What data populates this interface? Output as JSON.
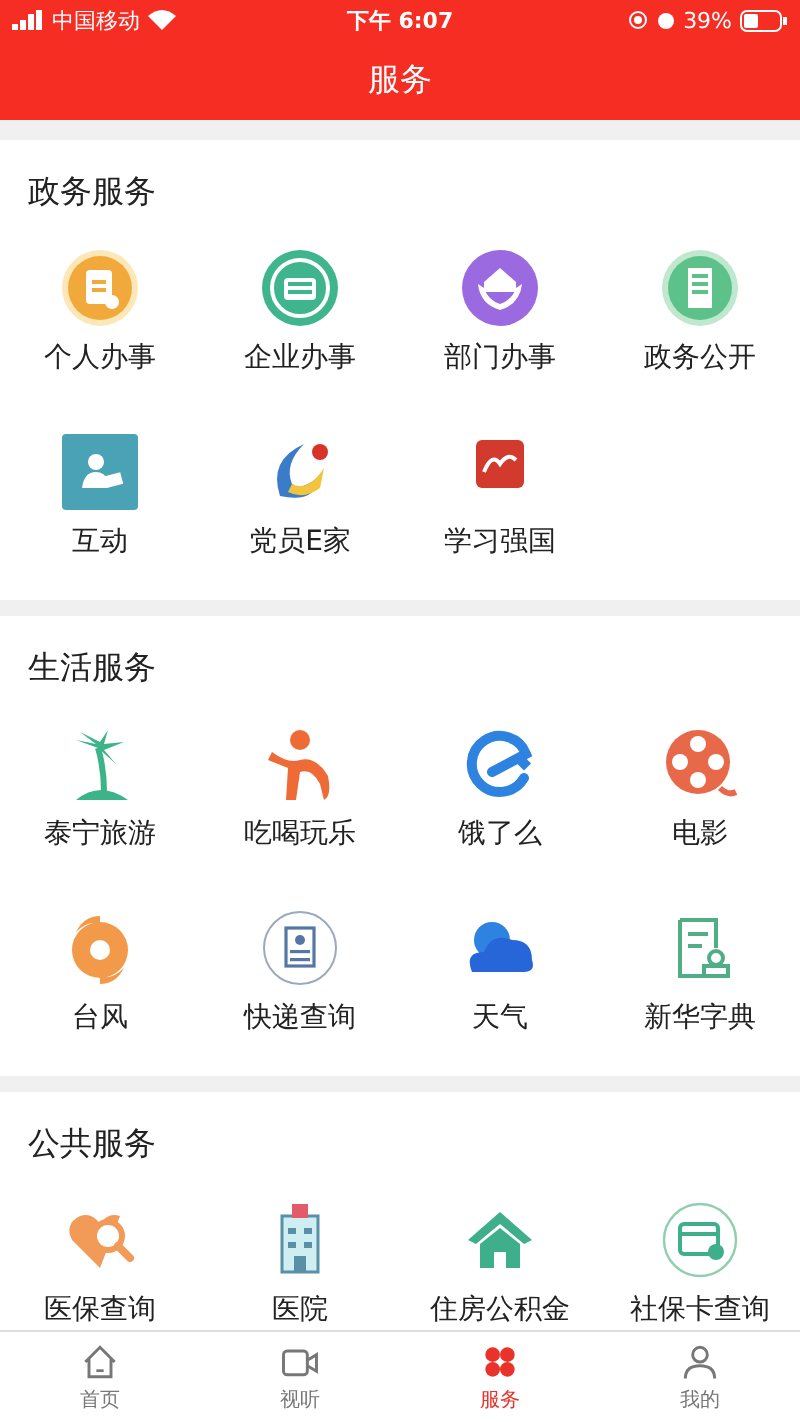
{
  "status_bar": {
    "carrier": "中国移动",
    "time": "下午 6:07",
    "battery": "39%"
  },
  "header": {
    "title": "服务"
  },
  "sections": [
    {
      "title": "政务服务",
      "items": [
        {
          "label": "个人办事"
        },
        {
          "label": "企业办事"
        },
        {
          "label": "部门办事"
        },
        {
          "label": "政务公开"
        },
        {
          "label": "互动"
        },
        {
          "label": "党员E家"
        },
        {
          "label": "学习强国"
        }
      ]
    },
    {
      "title": "生活服务",
      "items": [
        {
          "label": "泰宁旅游"
        },
        {
          "label": "吃喝玩乐"
        },
        {
          "label": "饿了么"
        },
        {
          "label": "电影"
        },
        {
          "label": "台风"
        },
        {
          "label": "快递查询"
        },
        {
          "label": "天气"
        },
        {
          "label": "新华字典"
        }
      ]
    },
    {
      "title": "公共服务",
      "items": [
        {
          "label": "医保查询"
        },
        {
          "label": "医院"
        },
        {
          "label": "住房公积金"
        },
        {
          "label": "社保卡查询"
        }
      ]
    }
  ],
  "tabs": [
    {
      "label": "首页",
      "selected": false
    },
    {
      "label": "视听",
      "selected": false
    },
    {
      "label": "服务",
      "selected": true
    },
    {
      "label": "我的",
      "selected": false
    }
  ]
}
